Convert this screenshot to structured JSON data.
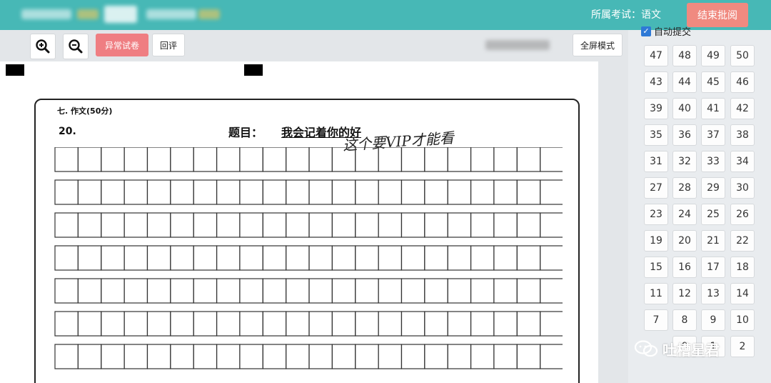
{
  "header": {
    "subject_text": "所属考试：语文",
    "end_button": "结束批阅"
  },
  "toolbar": {
    "abnormal_button": "异常试卷",
    "review_button": "回评",
    "fullscreen_button": "全屏模式"
  },
  "paper": {
    "section_title": "七. 作文(50分)",
    "question_number": "20.",
    "topic_label": "题目：",
    "topic_text": "我会记着你的好",
    "handwriting": "这个要VIP才能看"
  },
  "panel": {
    "auto_submit_label": "自动提交",
    "rows": [
      [
        "47",
        "48",
        "49",
        "50"
      ],
      [
        "43",
        "44",
        "45",
        "46"
      ],
      [
        "39",
        "40",
        "41",
        "42"
      ],
      [
        "35",
        "36",
        "37",
        "38"
      ],
      [
        "31",
        "32",
        "33",
        "34"
      ],
      [
        "27",
        "28",
        "29",
        "30"
      ],
      [
        "23",
        "24",
        "25",
        "26"
      ],
      [
        "19",
        "20",
        "21",
        "22"
      ],
      [
        "15",
        "16",
        "17",
        "18"
      ],
      [
        "11",
        "12",
        "13",
        "14"
      ],
      [
        "7",
        "8",
        "9",
        "10"
      ],
      [
        "",
        "0",
        "1",
        "2"
      ]
    ]
  },
  "watermark": {
    "text": "吐槽星君"
  },
  "colors": {
    "header": "#47b8b6",
    "end_button": "#f08a80",
    "abnormal_button": "#ef7e82"
  }
}
